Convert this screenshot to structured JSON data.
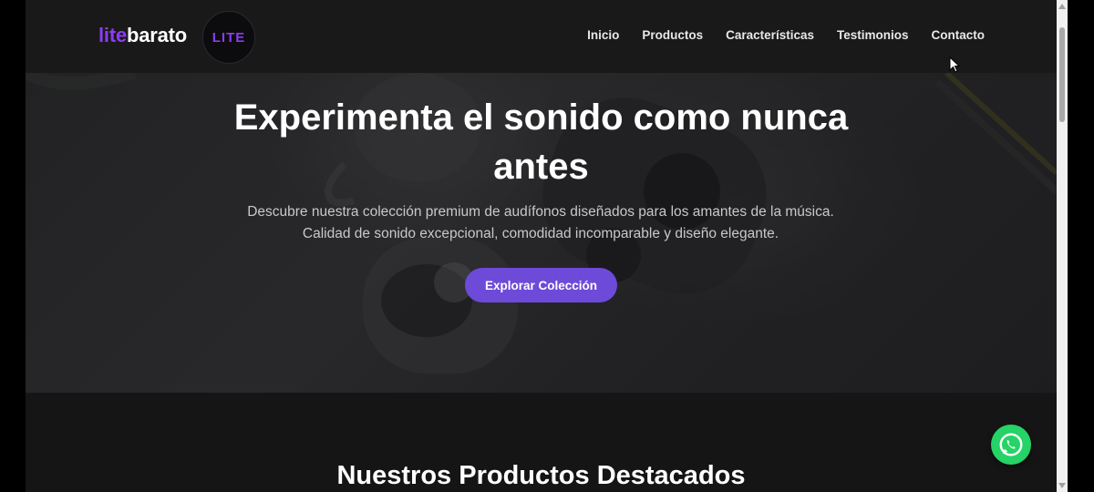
{
  "brand": {
    "part1": "lite",
    "part2": "barato",
    "badge": "LITE",
    "accent": "#8a3df0"
  },
  "nav": {
    "items": [
      {
        "label": "Inicio"
      },
      {
        "label": "Productos"
      },
      {
        "label": "Características"
      },
      {
        "label": "Testimonios"
      },
      {
        "label": "Contacto"
      }
    ]
  },
  "hero": {
    "title_line1": "Experimenta el sonido como nunca",
    "title_line2": "antes",
    "subtitle": "Descubre nuestra colección premium de audífonos diseñados para los amantes de la música. Calidad de sonido excepcional, comodidad incomparable y diseño elegante.",
    "cta_label": "Explorar Colección",
    "cta_color": "#6d4ad8"
  },
  "products": {
    "title": "Nuestros Productos Destacados"
  },
  "whatsapp": {
    "icon": "whatsapp-icon",
    "color": "#25d366"
  }
}
